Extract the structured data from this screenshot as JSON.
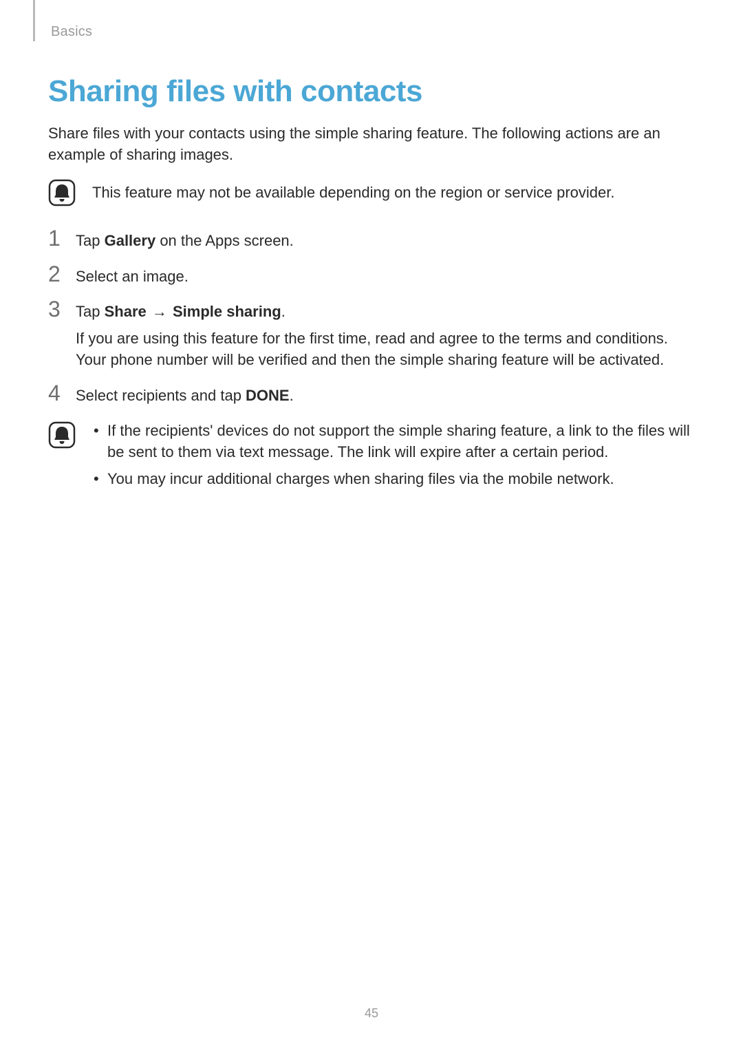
{
  "header": {
    "section": "Basics"
  },
  "title": "Sharing files with contacts",
  "intro": "Share files with your contacts using the simple sharing feature. The following actions are an example of sharing images.",
  "note1": "This feature may not be available depending on the region or service provider.",
  "steps": {
    "s1": {
      "pre": "Tap ",
      "bold": "Gallery",
      "post": " on the Apps screen."
    },
    "s2": {
      "text": "Select an image."
    },
    "s3": {
      "pre": "Tap ",
      "bold1": "Share",
      "arrow": " → ",
      "bold2": "Simple sharing",
      "post": ".",
      "sub": "If you are using this feature for the first time, read and agree to the terms and conditions. Your phone number will be verified and then the simple sharing feature will be activated."
    },
    "s4": {
      "pre": "Select recipients and tap ",
      "bold": "DONE",
      "post": "."
    }
  },
  "note2": {
    "b1": "If the recipients' devices do not support the simple sharing feature, a link to the files will be sent to them via text message. The link will expire after a certain period.",
    "b2": "You may incur additional charges when sharing files via the mobile network."
  },
  "pageNumber": "45"
}
